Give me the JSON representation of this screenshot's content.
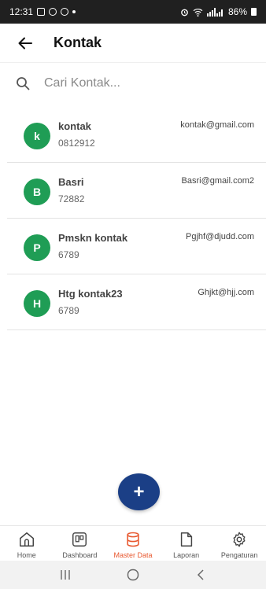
{
  "status_bar": {
    "time": "12:31",
    "battery": "86%"
  },
  "header": {
    "title": "Kontak"
  },
  "search": {
    "placeholder": "Cari Kontak..."
  },
  "contacts": [
    {
      "initial": "k",
      "name": "kontak",
      "phone": "0812912",
      "email": "kontak@gmail.com"
    },
    {
      "initial": "B",
      "name": "Basri",
      "phone": "72882",
      "email": "Basri@gmail.com2"
    },
    {
      "initial": "P",
      "name": "Pmskn kontak",
      "phone": "6789",
      "email": "Pgjhf@djudd.com"
    },
    {
      "initial": "H",
      "name": "Htg kontak23",
      "phone": "6789",
      "email": "Ghjkt@hjj.com"
    }
  ],
  "fab": {
    "label": "+"
  },
  "bottom_nav": [
    {
      "label": "Home",
      "icon": "home-icon"
    },
    {
      "label": "Dashboard",
      "icon": "dashboard-icon"
    },
    {
      "label": "Master Data",
      "icon": "database-icon",
      "active": true
    },
    {
      "label": "Laporan",
      "icon": "document-icon"
    },
    {
      "label": "Pengaturan",
      "icon": "gear-icon"
    }
  ],
  "colors": {
    "avatar": "#1f9d55",
    "fab": "#1b3f86",
    "active_tab": "#e8582f",
    "status_bar": "#202020"
  }
}
